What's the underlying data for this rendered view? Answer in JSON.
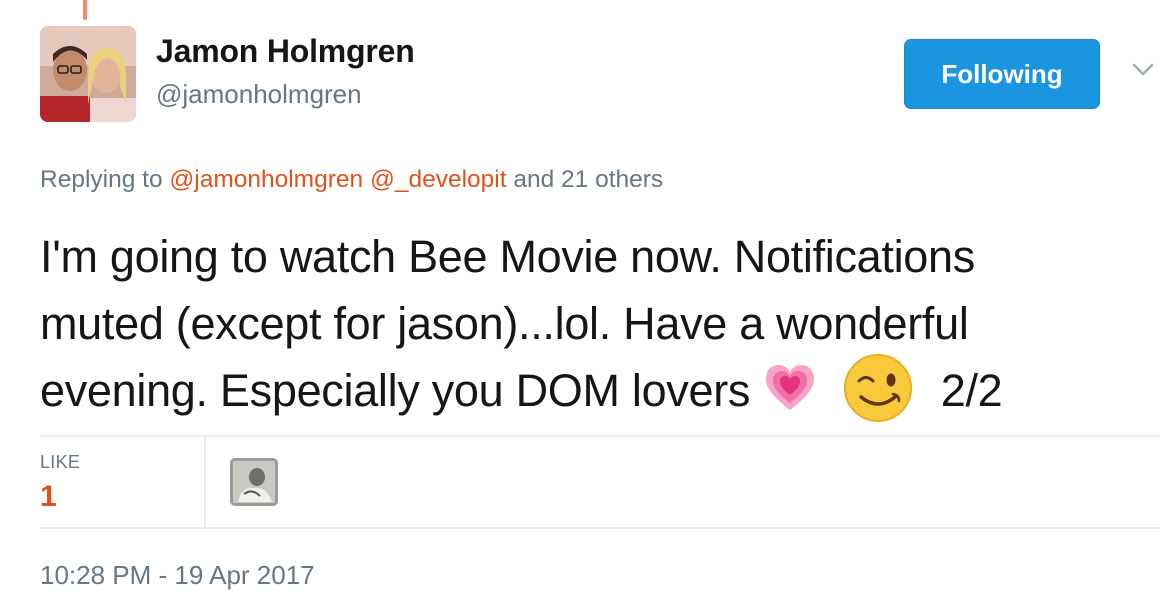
{
  "tweet": {
    "author": {
      "display_name": "Jamon Holmgren",
      "handle": "@jamonholmgren"
    },
    "follow_button_label": "Following",
    "reply_context": {
      "prefix": "Replying to",
      "mention_1": "@jamonholmgren",
      "mention_2": "@_developit",
      "suffix": "and 21 others"
    },
    "text": {
      "line1": "I'm going to watch Bee Movie now. Notifications",
      "line2": "muted (except for jason)...lol. Have a wonderful",
      "line3_before_emoji": "evening. Especially you DOM lovers",
      "line3_after_emoji": "2/2"
    },
    "emojis": [
      "growing-heart-icon",
      "winking-face-icon"
    ],
    "stats": {
      "like_label": "LIKE",
      "like_count": "1"
    },
    "timestamp": "10:28 PM - 19 Apr 2017"
  },
  "colors": {
    "accent": "#1b95e0",
    "mention": "#e0521c",
    "secondary_text": "#657786",
    "thread_line": "#f28f69"
  }
}
